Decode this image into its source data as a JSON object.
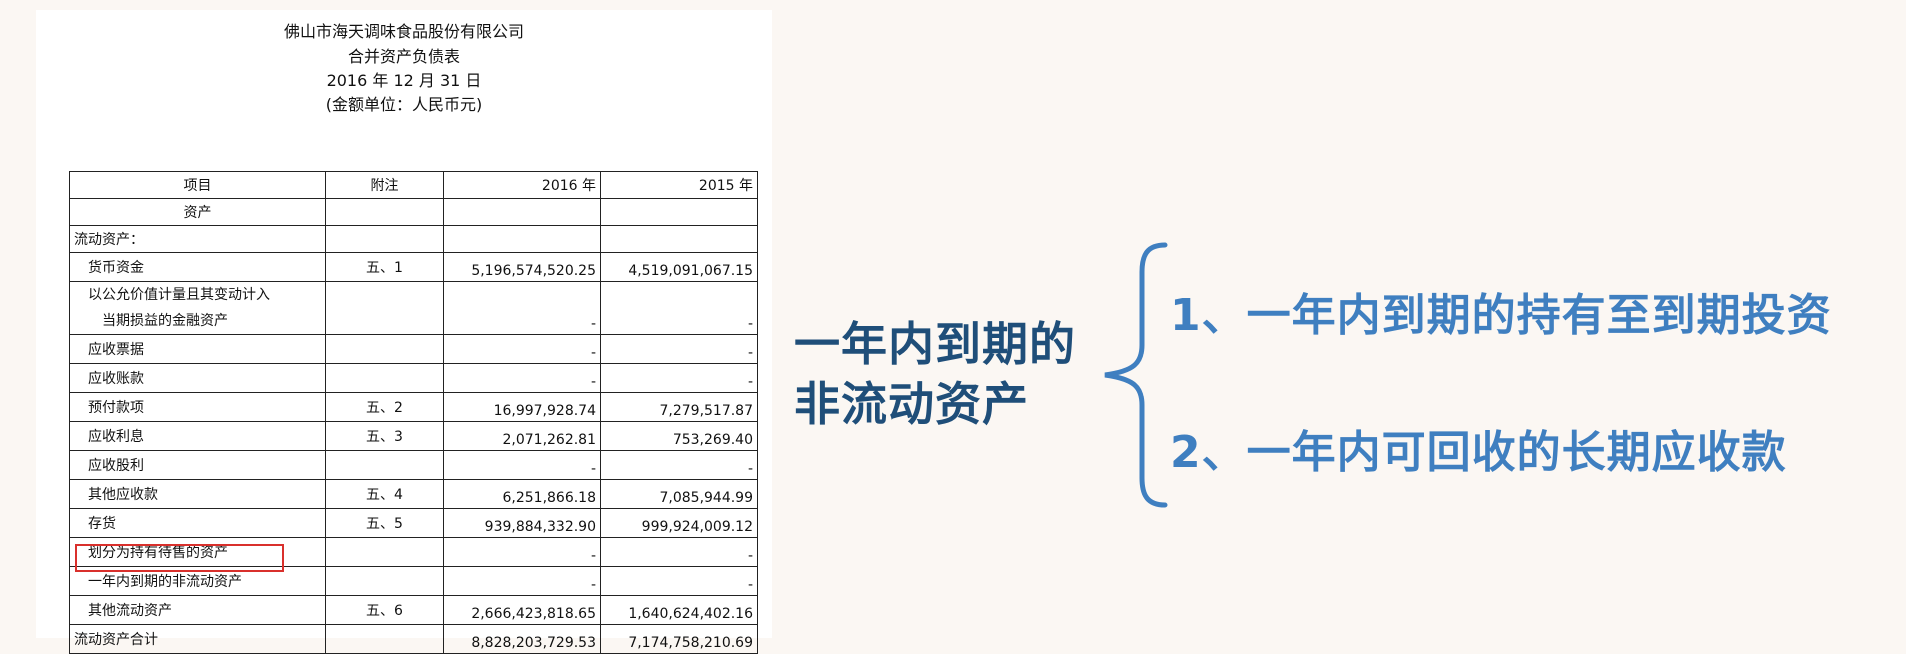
{
  "report": {
    "company": "佛山市海天调味食品股份有限公司",
    "title": "合并资产负债表",
    "date": "2016 年 12 月 31 日",
    "unit": "(金额单位：人民币元)"
  },
  "table": {
    "headers": [
      "项目",
      "附注",
      "2016 年",
      "2015 年"
    ],
    "rows": [
      {
        "item": "资产",
        "note": "",
        "y2016": "",
        "y2015": ""
      },
      {
        "item": "流动资产：",
        "note": "",
        "y2016": "",
        "y2015": ""
      },
      {
        "item": "货币资金",
        "note": "五、1",
        "y2016": "5,196,574,520.25",
        "y2015": "4,519,091,067.15"
      },
      {
        "item": "以公允价值计量且其变动计入",
        "item2": "当期损益的金融资产",
        "note": "",
        "y2016": "-",
        "y2015": "-"
      },
      {
        "item": "应收票据",
        "note": "",
        "y2016": "-",
        "y2015": "-"
      },
      {
        "item": "应收账款",
        "note": "",
        "y2016": "-",
        "y2015": "-"
      },
      {
        "item": "预付款项",
        "note": "五、2",
        "y2016": "16,997,928.74",
        "y2015": "7,279,517.87"
      },
      {
        "item": "应收利息",
        "note": "五、3",
        "y2016": "2,071,262.81",
        "y2015": "753,269.40"
      },
      {
        "item": "应收股利",
        "note": "",
        "y2016": "-",
        "y2015": "-"
      },
      {
        "item": "其他应收款",
        "note": "五、4",
        "y2016": "6,251,866.18",
        "y2015": "7,085,944.99"
      },
      {
        "item": "存货",
        "note": "五、5",
        "y2016": "939,884,332.90",
        "y2015": "999,924,009.12"
      },
      {
        "item": "划分为持有待售的资产",
        "note": "",
        "y2016": "-",
        "y2015": "-"
      },
      {
        "item": "一年内到期的非流动资产",
        "note": "",
        "y2016": "-",
        "y2015": "-"
      },
      {
        "item": "其他流动资产",
        "note": "五、6",
        "y2016": "2,666,423,818.65",
        "y2015": "1,640,624,402.16"
      },
      {
        "item": "流动资产合计",
        "note": "",
        "y2016": "8,828,203,729.53",
        "y2015": "7,174,758,210.69"
      }
    ]
  },
  "annotation": {
    "topic_line1": "一年内到期的",
    "topic_line2": "非流动资产",
    "point1": "1、一年内到期的持有至到期投资",
    "point2": "2、一年内可回收的长期应收款",
    "highlight_color": "#d9302c",
    "topic_color": "#1f4e79",
    "point_color": "#3f7fc0"
  }
}
